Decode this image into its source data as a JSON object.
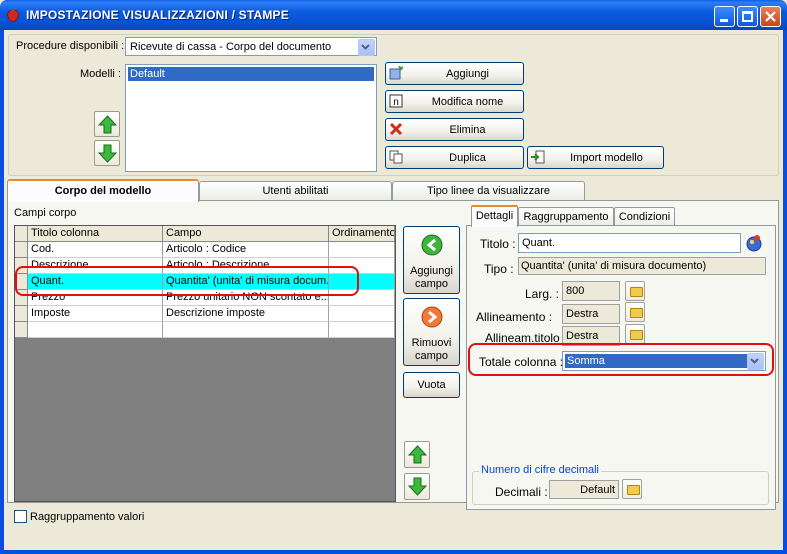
{
  "window": {
    "title": "IMPOSTAZIONE VISUALIZZAZIONI / STAMPE"
  },
  "procedure": {
    "label": "Procedure disponibili :",
    "value": "Ricevute di cassa - Corpo del documento"
  },
  "modelli": {
    "label": "Modelli :",
    "items": [
      "Default"
    ]
  },
  "model_buttons": {
    "aggiungi": "Aggiungi",
    "modifica_nome": "Modifica nome",
    "elimina": "Elimina",
    "duplica": "Duplica",
    "import_modello": "Import modello"
  },
  "tabs": [
    "Corpo del modello",
    "Utenti abilitati",
    "Tipo linee da visualizzare"
  ],
  "corpo": {
    "label": "Campi corpo",
    "columns": [
      "Titolo colonna",
      "Campo",
      "Ordinamento"
    ],
    "rows": [
      [
        "Cod.",
        "Articolo : Codice",
        ""
      ],
      [
        "Descrizione",
        "Articolo : Descrizione",
        ""
      ],
      [
        "Quant.",
        "Quantita' (unita' di misura docum...",
        ""
      ],
      [
        "Prezzo",
        "Prezzo unitario NON scontato e...",
        ""
      ],
      [
        "Imposte",
        "Descrizione imposte",
        ""
      ],
      [
        "",
        "",
        ""
      ]
    ],
    "selected_row": 2
  },
  "field_buttons": {
    "aggiungi_campo": "Aggiungi campo",
    "rimuovi_campo": "Rimuovi campo",
    "vuota": "Vuota"
  },
  "detail_tabs": [
    "Dettagli",
    "Raggruppamento",
    "Condizioni"
  ],
  "dettagli": {
    "titolo_label": "Titolo :",
    "titolo_value": "Quant.",
    "tipo_label": "Tipo :",
    "tipo_value": "Quantita' (unita' di misura documento)",
    "larg_label": "Larg. :",
    "larg_value": "800",
    "allineamento_label": "Allineamento :",
    "allineamento_value": "Destra",
    "allineam_titolo_label": "Allineam.titolo :",
    "allineam_titolo_value": "Destra",
    "totale_label": "Totale colonna :",
    "totale_value": "Somma",
    "decimali_group": "Numero di cifre decimali",
    "decimali_label": "Decimali :",
    "decimali_value": "Default"
  },
  "raggruppamento_valori": {
    "label": "Raggruppamento valori",
    "checked": false
  },
  "colors": {
    "title_bar": "#0a5ee6",
    "selection": "#00ffff",
    "highlight": "#e01010",
    "accent_tab": "#e68b2c"
  }
}
